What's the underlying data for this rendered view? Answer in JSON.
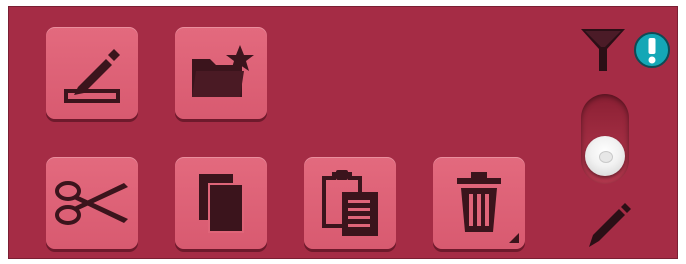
{
  "toolbar": {
    "buttons": [
      {
        "id": "edit",
        "icon": "pencil-box-icon"
      },
      {
        "id": "favorite-folder",
        "icon": "folder-star-icon"
      },
      {
        "id": "cut",
        "icon": "scissors-icon"
      },
      {
        "id": "copy",
        "icon": "copy-icon"
      },
      {
        "id": "paste",
        "icon": "clipboard-icon"
      },
      {
        "id": "delete",
        "icon": "trash-icon"
      }
    ]
  },
  "side_controls": {
    "filter_icon": "funnel-icon",
    "alert_icon": "exclamation-badge-icon",
    "alert_color": "#14a7b6",
    "toggle_state": "off",
    "edit_icon": "pencil-icon"
  },
  "colors": {
    "panel": "#a52c45",
    "button": "#df6579",
    "icon": "#3b141c"
  }
}
